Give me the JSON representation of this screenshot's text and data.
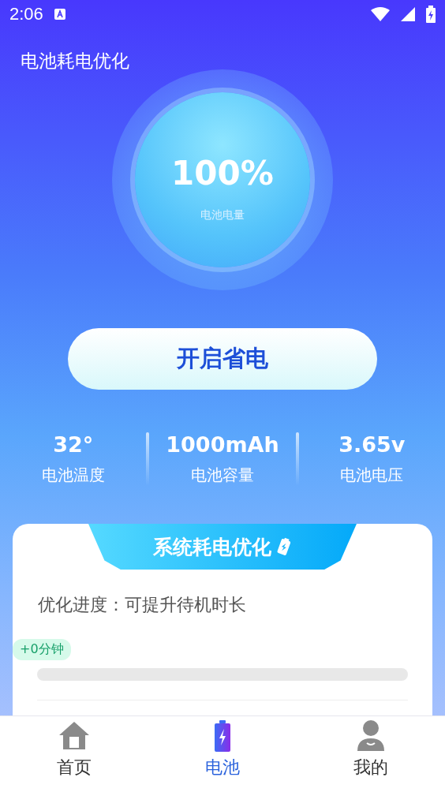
{
  "status_bar": {
    "time": "2:06"
  },
  "title": "电池耗电优化",
  "battery": {
    "percent": "100%",
    "label": "电池电量"
  },
  "action_button": "开启省电",
  "stats": [
    {
      "value": "32°",
      "label": "电池温度"
    },
    {
      "value": "1000mAh",
      "label": "电池容量"
    },
    {
      "value": "3.65v",
      "label": "电池电压"
    }
  ],
  "card": {
    "heading": "系统耗电优化",
    "progress_text": "优化进度：可提升待机时长",
    "gain_badge": "+0分钟",
    "level": 0
  },
  "tabs": [
    {
      "label": "首页",
      "kind": "home",
      "selected": false
    },
    {
      "label": "电池",
      "kind": "battery",
      "selected": true
    },
    {
      "label": "我的",
      "kind": "profile",
      "selected": false
    }
  ]
}
